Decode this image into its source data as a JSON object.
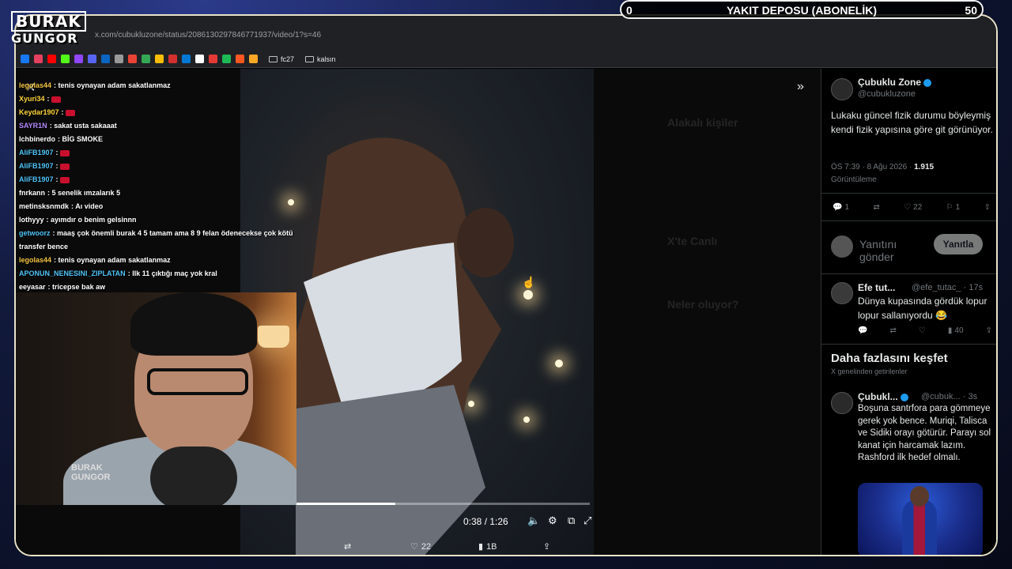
{
  "browser": {
    "url": "x.com/cubukluzone/status/2086130297846771937/video/1?s=46",
    "bookmarks_folders": [
      "fc27",
      "kalsın"
    ]
  },
  "overlay": {
    "logo_line1": "BURAK",
    "logo_line2": "GUNGOR",
    "goal": {
      "current": "0",
      "title": "YAKIT DEPOSU (ABONELİK)",
      "target": "50"
    }
  },
  "chat": [
    {
      "user": "legolas44",
      "text": "tenis oynayan adam sakatlanmaz",
      "color": "#f4c542"
    },
    {
      "user": "Xyuri34",
      "text": "",
      "color": "#ffd43b",
      "emote": true
    },
    {
      "user": "Keydar1907",
      "text": "",
      "color": "#ffd43b",
      "emote": true
    },
    {
      "user": "SAYR1N",
      "text": "sakat usta sakaaat",
      "color": "#b388ff"
    },
    {
      "user": "Ichbinerdo",
      "text": "BİG SMOKE",
      "color": "#ffffff"
    },
    {
      "user": "AliFB1907",
      "text": "",
      "color": "#4fc3f7",
      "emote": true
    },
    {
      "user": "AliFB1907",
      "text": "",
      "color": "#4fc3f7",
      "emote": true
    },
    {
      "user": "AliFB1907",
      "text": "",
      "color": "#4fc3f7",
      "emote": true
    },
    {
      "user": "fnrkann",
      "text": "5 senelik ımzalarık 5",
      "color": "#ffffff"
    },
    {
      "user": "metinsksnmdk",
      "text": "Aı video",
      "color": "#ffffff"
    },
    {
      "user": "lothyyy",
      "text": "ayımdır o benim gelsinnn",
      "color": "#ffffff"
    },
    {
      "user": "getwoorz",
      "text": "maaş çok önemli burak 4 5 tamam ama 8 9 felan ödenecekse çok kötü",
      "color": "#4fc3f7"
    },
    {
      "user": "",
      "text": "transfer bence",
      "color": "#ffffff"
    },
    {
      "user": "legolas44",
      "text": "tenis oynayan adam sakatlanmaz",
      "color": "#f4c542"
    },
    {
      "user": "APONUN_NENESINI_ZIPLATAN",
      "text": "Ilk 11 çıktığı maç yok kral",
      "color": "#4fc3f7"
    },
    {
      "user": "eeyasar",
      "text": "tricepse bak aw",
      "color": "#ffffff"
    }
  ],
  "webcam": {
    "logo_line1": "BURAK",
    "logo_line2": "GUNGOR"
  },
  "video": {
    "time": "0:38 / 1:26",
    "progress": 0.34,
    "actions": {
      "likes": "22",
      "views": "1B"
    }
  },
  "tweet": {
    "name": "Çubuklu Zone",
    "handle": "@cubukluzone",
    "text": "Lukaku güncel fizik durumu böyleymiş kendi fizik yapısına göre git görünüyor.",
    "time": "ÖS 7:39 · 8 Ağu 2026 ·",
    "views": "1.915",
    "views_label": "Görüntüleme",
    "replies": "1",
    "likes": "22",
    "bookmarks": "1"
  },
  "reply_box": {
    "placeholder": "Yanıtını gönder",
    "button": "Yanıtla"
  },
  "reply1": {
    "name": "Efe tut...",
    "handle": "@efe_tutac_",
    "time": "· 17s",
    "text": "Dünya kupasında gördük lopur lopur sallanıyordu 😂",
    "views": "40"
  },
  "explore": {
    "title": "Daha fazlasını keşfet",
    "subtitle": "X genelinden getirilenler"
  },
  "reply2": {
    "name": "Çubukl...",
    "handle": "@cubuk...",
    "time": "· 3s",
    "text": "Boşuna santrfora para gömmeye gerek yok bence. Muriqi, Talisca ve Sidiki orayı götürür. Parayı sol kanat için harcamak lazım. Rashford ilk hedef olmalı."
  }
}
